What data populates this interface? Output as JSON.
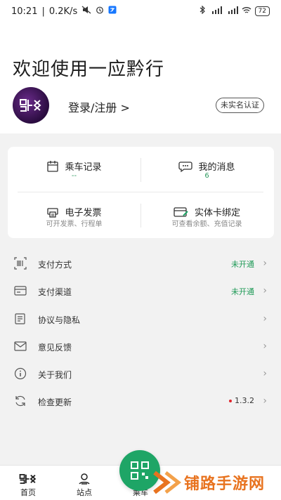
{
  "status_bar": {
    "time": "10:21",
    "speed": "0.2K/s",
    "battery": "72"
  },
  "header": {
    "welcome": "欢迎使用一应黔行",
    "login": "登录/注册 >",
    "verify_badge": "未实名认证"
  },
  "quick": [
    {
      "title": "乘车记录",
      "sub": "--",
      "icon": "calendar-icon"
    },
    {
      "title": "我的消息",
      "sub": "6",
      "icon": "chat-bubble-icon"
    },
    {
      "title": "电子发票",
      "sub": "可开发票、行程单",
      "icon": "invoice-printer-icon"
    },
    {
      "title": "实体卡绑定",
      "sub": "可查看余额、充值记录",
      "icon": "card-bind-icon"
    }
  ],
  "menu": [
    {
      "label": "支付方式",
      "value": "未开通",
      "icon": "barcode-icon"
    },
    {
      "label": "支付渠道",
      "value": "未开通",
      "icon": "bank-card-icon"
    },
    {
      "label": "协议与隐私",
      "value": "",
      "icon": "document-icon"
    },
    {
      "label": "意见反馈",
      "value": "",
      "icon": "envelope-icon"
    },
    {
      "label": "关于我们",
      "value": "",
      "icon": "info-icon"
    },
    {
      "label": "检查更新",
      "value": "1.3.2",
      "icon": "refresh-icon"
    }
  ],
  "tabs": [
    {
      "label": "首页",
      "icon": "home-logo-icon"
    },
    {
      "label": "站点",
      "icon": "station-icon"
    },
    {
      "label": "乘车",
      "icon": "qr-code-icon"
    }
  ],
  "watermark": {
    "text": "铺路手游网"
  },
  "colors": {
    "accent": "#1ea566",
    "update_dot": "#e0242b",
    "watermark": "#e8731f"
  }
}
